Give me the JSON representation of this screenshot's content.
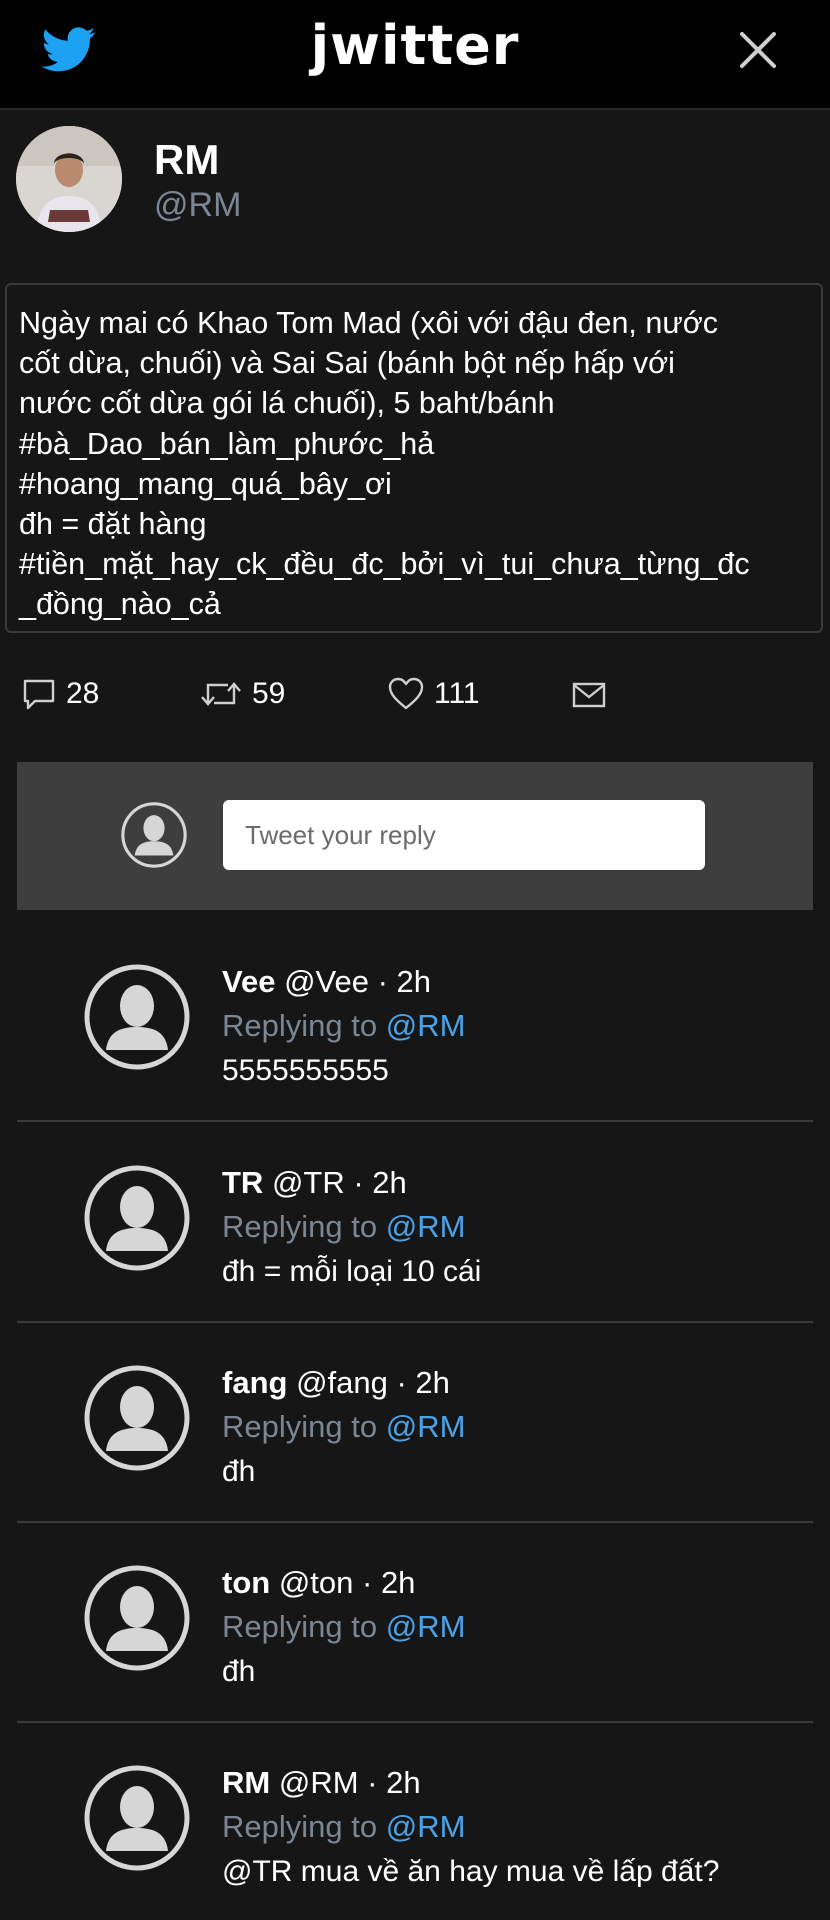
{
  "header": {
    "brand": "jwitter",
    "bird_icon": "twitter-bird-icon",
    "close_icon": "close-icon",
    "bird_color": "#1da1f2"
  },
  "tweet": {
    "author_name": "RM",
    "author_handle": "@RM",
    "lines": [
      "Ngày mai có Khao Tom Mad (xôi với đậu đen, nước",
      "cốt dừa, chuối) và Sai Sai (bánh bột nếp hấp với",
      "nước cốt dừa gói lá chuối), 5 baht/bánh",
      "#bà_Dao_bán_làm_phước_hả",
      "#hoang_mang_quá_bây_ơi",
      "đh = đặt hàng",
      "#tiền_mặt_hay_ck_đều_đc_bởi_vì_tui_chưa_từng_đc",
      "_đồng_nào_cả"
    ]
  },
  "actions": {
    "replies": "28",
    "retweets": "59",
    "likes": "111",
    "reply_icon": "comment-icon",
    "retweet_icon": "retweet-icon",
    "like_icon": "heart-icon",
    "message_icon": "mail-icon"
  },
  "reply_box": {
    "placeholder": "Tweet your reply"
  },
  "replies": [
    {
      "name": "Vee",
      "meta": "@Vee · 2h",
      "replying_prefix": "Replying to",
      "mention": "@RM",
      "text": "5555555555"
    },
    {
      "name": "TR",
      "meta": "@TR · 2h",
      "replying_prefix": "Replying to",
      "mention": "@RM",
      "text": "đh = mỗi loại 10 cái"
    },
    {
      "name": "fang",
      "meta": "@fang · 2h",
      "replying_prefix": "Replying to",
      "mention": "@RM",
      "text": "đh"
    },
    {
      "name": "ton",
      "meta": "@ton · 2h",
      "replying_prefix": "Replying to",
      "mention": "@RM",
      "text": "đh"
    },
    {
      "name": "RM",
      "meta": "@RM · 2h",
      "replying_prefix": "Replying to",
      "mention": "@RM",
      "text": "@TR mua về ăn hay mua về lấp đất?"
    }
  ],
  "colors": {
    "background": "#161616",
    "topbar": "#000000",
    "muted": "#7b8694",
    "mention": "#4aa3e8"
  }
}
